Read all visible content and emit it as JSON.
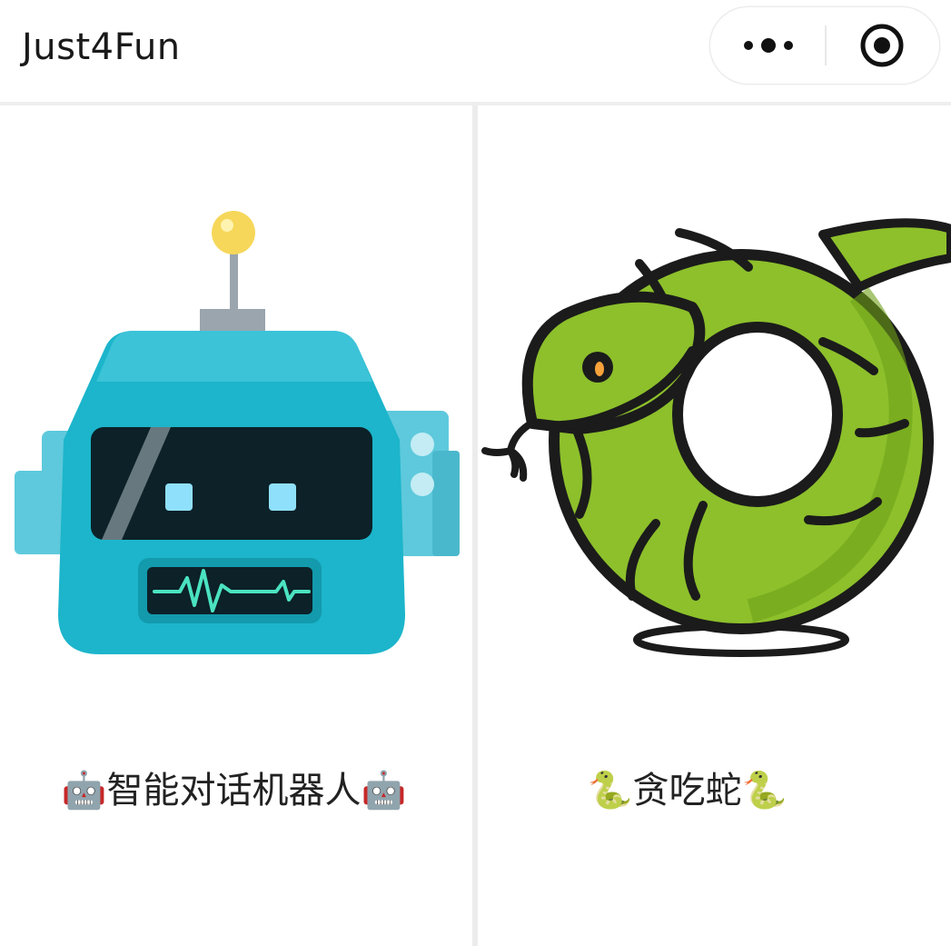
{
  "app": {
    "title": "Just4Fun"
  },
  "capsule": {
    "menu_icon": "more-dots-icon",
    "close_icon": "target-circle-icon"
  },
  "cards": [
    {
      "label": "🤖智能对话机器人🤖",
      "icon": "robot-illustration"
    },
    {
      "label": "🐍贪吃蛇🐍",
      "icon": "snake-illustration"
    }
  ],
  "colors": {
    "robot_body": "#1cb5cb",
    "robot_screen": "#0c2128",
    "robot_eye": "#8fe0fa",
    "snake_green": "#8dc02b",
    "snake_outline": "#1b1b1b",
    "divider": "#ececec"
  }
}
